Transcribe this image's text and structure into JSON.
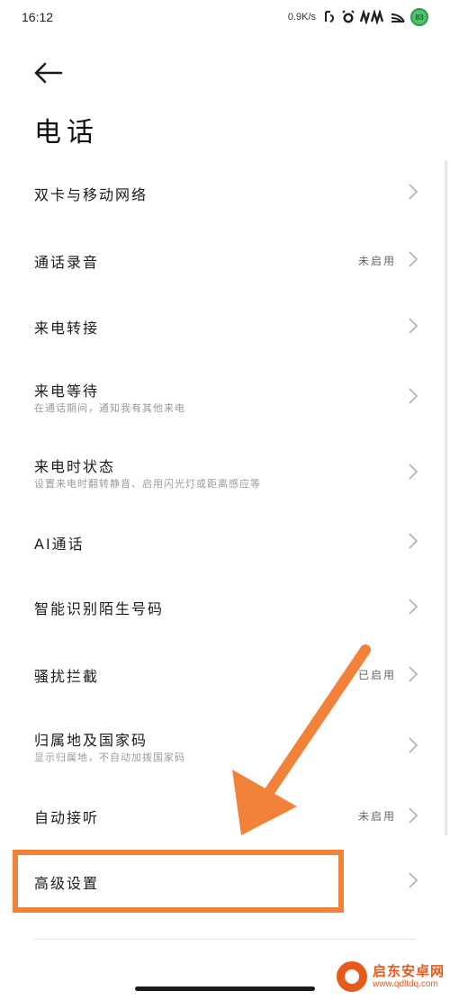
{
  "status_bar": {
    "time": "16:12",
    "net_speed": "0.9K/s",
    "battery": "83"
  },
  "page": {
    "title": "电话"
  },
  "settings": [
    {
      "label": "双卡与移动网络",
      "sub": "",
      "value": ""
    },
    {
      "label": "通话录音",
      "sub": "",
      "value": "未启用"
    },
    {
      "label": "来电转接",
      "sub": "",
      "value": ""
    },
    {
      "label": "来电等待",
      "sub": "在通话期间，通知我有其他来电",
      "value": ""
    },
    {
      "label": "来电时状态",
      "sub": "设置来电时翻转静音、启用闪光灯或距离感应等",
      "value": ""
    },
    {
      "label": "AI通话",
      "sub": "",
      "value": ""
    },
    {
      "label": "智能识别陌生号码",
      "sub": "",
      "value": ""
    },
    {
      "label": "骚扰拦截",
      "sub": "",
      "value": "已启用"
    },
    {
      "label": "归属地及国家码",
      "sub": "显示归属地，不自动加拨国家码",
      "value": ""
    },
    {
      "label": "自动接听",
      "sub": "",
      "value": "未启用"
    },
    {
      "label": "高级设置",
      "sub": "",
      "value": ""
    }
  ],
  "annotation": {
    "color": "#f2813a"
  },
  "watermark": {
    "name": "启东安卓网",
    "url": "www.qdltdq.com"
  }
}
